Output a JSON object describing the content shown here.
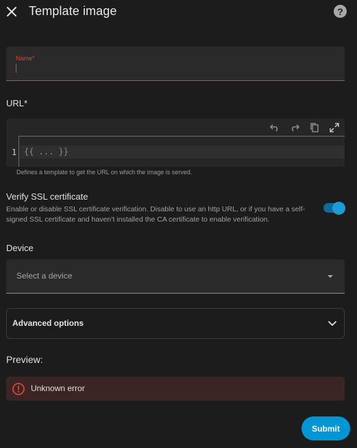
{
  "dialog": {
    "title": "Template image",
    "close_icon": "close-icon",
    "help_icon": "help-circle-icon",
    "help_glyph": "?"
  },
  "name_field": {
    "label": "Name*",
    "value": "",
    "state": "error-focused",
    "accent_color": "#db4437"
  },
  "url_field": {
    "label": "URL*",
    "toolbar_icons": [
      "undo-icon",
      "redo-icon",
      "copy-icon",
      "fullscreen-icon"
    ],
    "line_number": "1",
    "code": "{{ ... }}",
    "helper": "Defines a template to get the URL on which the image is served."
  },
  "verify_ssl": {
    "title": "Verify SSL certificate",
    "description": "Enable or disable SSL certificate verification. Disable to use an http URL, or if you have a self-signed SSL certificate and haven’t installed the CA certificate to enable verification.",
    "enabled": true,
    "accent_color": "#1e9bd7"
  },
  "device": {
    "label": "Device",
    "placeholder": "Select a device",
    "icon": "dropdown-arrow-icon"
  },
  "advanced": {
    "label": "Advanced options",
    "expanded": false,
    "icon": "chevron-down-icon"
  },
  "preview": {
    "label": "Preview:",
    "alert_text": "Unknown error",
    "alert_icon": "error-icon",
    "alert_color": "#db4437"
  },
  "actions": {
    "submit_label": "Submit",
    "submit_color": "#0096d6"
  }
}
